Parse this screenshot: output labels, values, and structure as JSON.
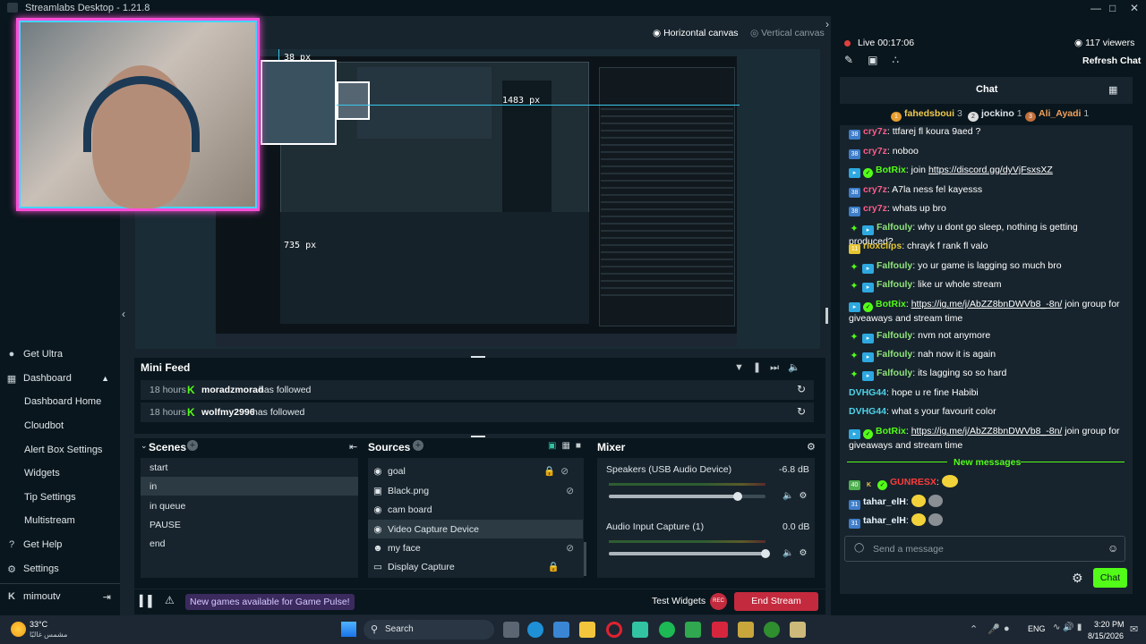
{
  "app": {
    "title": "Streamlabs Desktop - 1.21.8"
  },
  "canvas_tabs": {
    "horizontal": "Horizontal canvas",
    "vertical": "Vertical canvas"
  },
  "preview": {
    "measure_top": "38 px",
    "measure_left": "735 px",
    "measure_right": "1483 px"
  },
  "sidebar": {
    "get_ultra": "Get Ultra",
    "dashboard": "Dashboard",
    "sub_items": [
      "Dashboard Home",
      "Cloudbot",
      "Alert Box Settings",
      "Widgets",
      "Tip Settings",
      "Multistream"
    ],
    "get_help": "Get Help",
    "settings": "Settings",
    "user": "mimoutv"
  },
  "mini_feed": {
    "title": "Mini Feed",
    "events": [
      {
        "time": "18 hours",
        "user": "moradzmorad",
        "action": "has followed"
      },
      {
        "time": "18 hours",
        "user": "wolfmy2996",
        "action": "has followed"
      }
    ]
  },
  "scenes": {
    "title": "Scenes",
    "items": [
      "start",
      "in",
      "in queue",
      "PAUSE",
      "end"
    ],
    "selected": "in"
  },
  "sources": {
    "title": "Sources",
    "items": [
      "goal",
      "Black.png",
      "cam board",
      "Video Capture Device",
      "my face",
      "Display Capture"
    ],
    "selected": "Video Capture Device"
  },
  "mixer": {
    "title": "Mixer",
    "channels": [
      {
        "name": "Speakers (USB Audio Device)",
        "db": "-6.8 dB",
        "level": 0.82
      },
      {
        "name": "Audio Input Capture (1)",
        "db": "0.0 dB",
        "level": 1.0
      }
    ]
  },
  "footer": {
    "notice": "New games available for Game Pulse!",
    "test_widgets": "Test Widgets",
    "end_stream": "End Stream"
  },
  "live": {
    "label": "Live",
    "time": "00:17:06",
    "viewers": "117 viewers",
    "refresh": "Refresh Chat"
  },
  "chat": {
    "title": "Chat",
    "top": [
      {
        "rank": "1",
        "name": "fahedsboui",
        "count": "3"
      },
      {
        "rank": "2",
        "name": "jockino",
        "count": "1"
      },
      {
        "rank": "3",
        "name": "Ali_Ayadi",
        "count": "1"
      }
    ],
    "messages": [
      {
        "user": "cry7z",
        "text": ": ttfarej fl koura 9aed ?"
      },
      {
        "user": "cry7z",
        "text": ": noboo"
      },
      {
        "user": "BotRix",
        "text": ": join ",
        "link": "https://discord.gg/dyVjFsxsXZ"
      },
      {
        "user": "cry7z",
        "text": ": A7la ness fel kayesss"
      },
      {
        "user": "cry7z",
        "text": ": whats up bro"
      },
      {
        "user": "Falfouly",
        "text": ": why u dont go sleep, nothing is getting produced?"
      },
      {
        "user": "rioxclips",
        "text": ": chrayk f rank fl valo"
      },
      {
        "user": "Falfouly",
        "text": ": yo ur game is lagging so much bro"
      },
      {
        "user": "Falfouly",
        "text": ": like ur whole stream"
      },
      {
        "user": "BotRix",
        "text": ": ",
        "link": "https://ig.me/j/AbZZ8bnDWVb8_-8n/",
        "text2": " join group for giveaways and stream time"
      },
      {
        "user": "Falfouly",
        "text": ": nvm not anymore"
      },
      {
        "user": "Falfouly",
        "text": ": nah now it is again"
      },
      {
        "user": "Falfouly",
        "text": ": its lagging so so hard"
      },
      {
        "user": "DVHG44",
        "text": ": hope u re fine Habibi"
      },
      {
        "user": "DVHG44",
        "text": ": what s your favourit color"
      },
      {
        "user": "BotRix",
        "text": ": ",
        "link": "https://ig.me/j/AbZZ8bnDWVb8_-8n/",
        "text2": " join group for giveaways and stream time"
      }
    ],
    "new_messages": "New messages",
    "new": [
      {
        "user": "GUNRESX",
        "text": ":"
      },
      {
        "user": "tahar_elH",
        "text": ":"
      },
      {
        "user": "tahar_elH",
        "text": ":"
      }
    ],
    "input_placeholder": "Send a message",
    "send": "Chat"
  },
  "taskbar": {
    "weather_temp": "33°C",
    "weather_desc": "مشمس غالبًا",
    "search": "Search",
    "lang": "ENG",
    "time": "3:20 PM",
    "date": "8/15/2026"
  },
  "colors": {
    "accent": "#53fc18",
    "bg": "#17242d",
    "dark": "#09161d",
    "end_stream": "#c42a3d"
  }
}
